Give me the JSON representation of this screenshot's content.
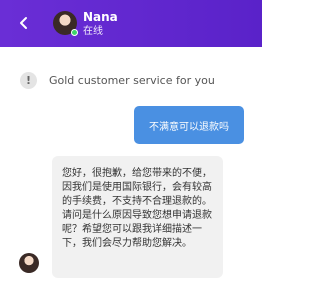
{
  "header": {
    "agent_name": "Nana",
    "status": "在线",
    "bg_color": "#5a22c9"
  },
  "system_note": {
    "icon": "exclamation-icon",
    "text": "Gold customer service for you"
  },
  "messages": {
    "user": {
      "text": "不满意可以退款吗",
      "color": "#4a90e2"
    },
    "agent": {
      "text": "您好，很抱歉，给您带来的不便，因我们是使用国际银行，会有较高的手续费，不支持不合理退款的。请问是什么原因导致您想申请退款呢？希望您可以跟我详细描述一下，我们会尽力帮助您解决。"
    }
  }
}
